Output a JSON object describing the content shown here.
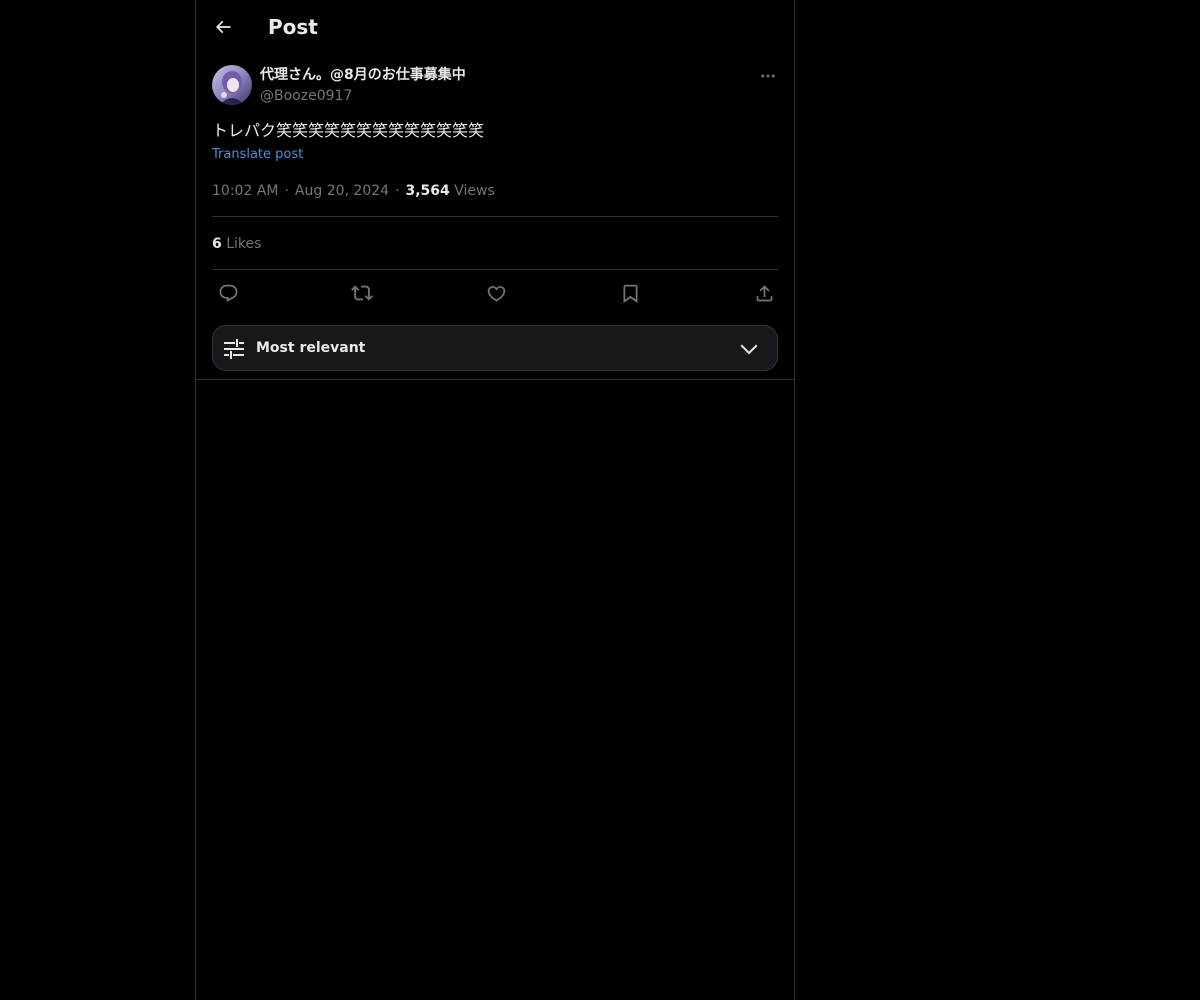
{
  "header": {
    "title": "Post",
    "back_icon": "arrow-left-icon"
  },
  "author": {
    "display_name": "代理さん。@8月のお仕事募集中",
    "handle": "@Booze0917",
    "avatar_icon": "user-avatar"
  },
  "post": {
    "text": "トレパク笑笑笑笑笑笑笑笑笑笑笑笑笑",
    "translate_label": "Translate post",
    "time": "10:02 AM",
    "date": "Aug 20, 2024",
    "views_count": "3,564",
    "views_label": "Views",
    "separator": "·",
    "likes_count": "6",
    "likes_label": "Likes"
  },
  "actions": {
    "icons": [
      "reply-icon",
      "repost-icon",
      "like-icon",
      "bookmark-icon",
      "share-icon"
    ]
  },
  "sort": {
    "label": "Most relevant",
    "icon": "filter-sliders-icon"
  },
  "colors": {
    "background": "#000000",
    "text_primary": "#e7e9ea",
    "text_secondary": "#71767b",
    "link": "#4a8fd6",
    "border": "#2f3336",
    "dropdown_bg": "#16181c"
  }
}
